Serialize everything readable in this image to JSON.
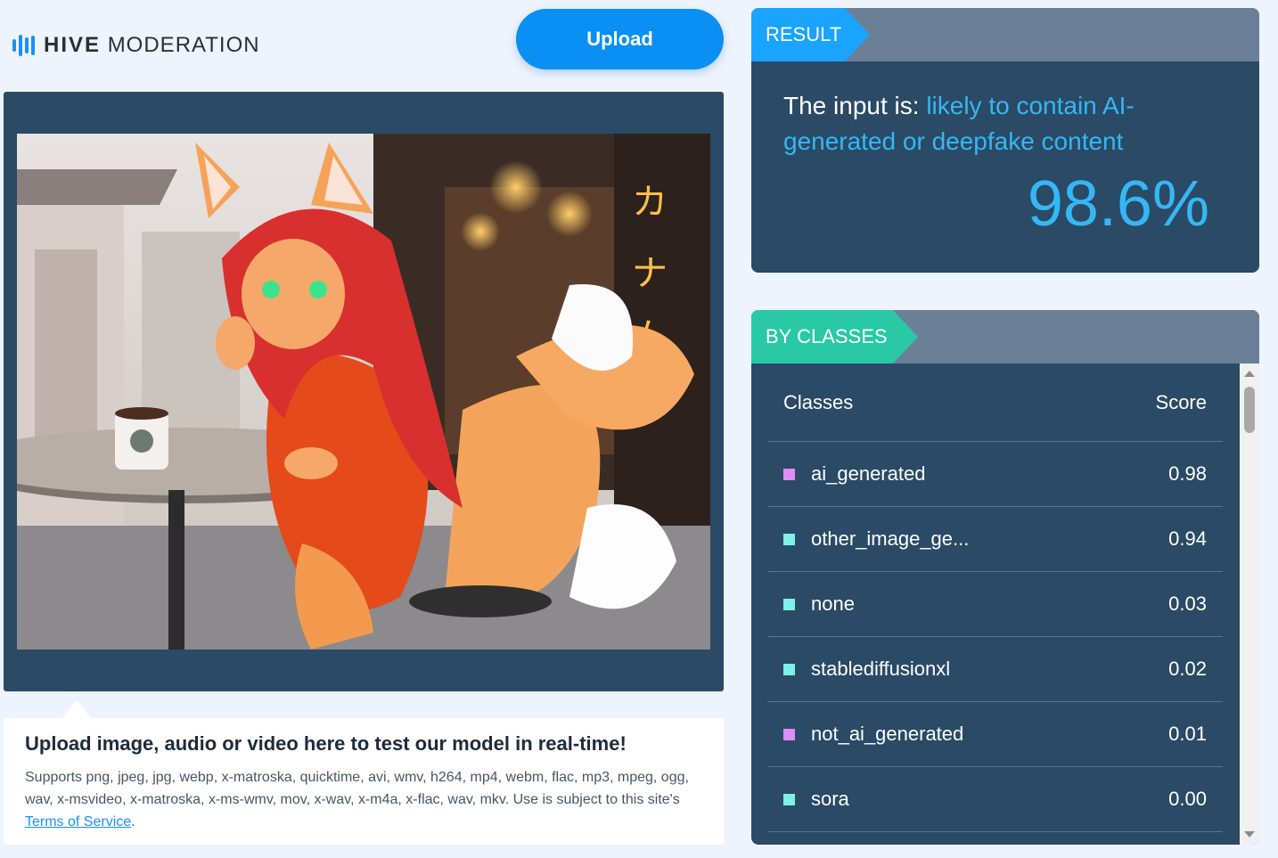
{
  "brand": {
    "bold": "HIVE",
    "light": "MODERATION"
  },
  "upload_button": "Upload",
  "preview": {
    "image_subject": "anime fox girl with red hair in orange dress sitting at café table with coffee mug, three fox tails"
  },
  "info": {
    "title": "Upload image, audio or video here to test our model in real-time!",
    "supports": "Supports png, jpeg, jpg, webp, x-matroska, quicktime, avi, wmv, h264, mp4, webm, flac, mp3, mpeg, ogg, wav, x-msvideo, x-matroska, x-ms-wmv, mov, x-wav, x-m4a, x-flac, wav, mkv. Use is subject to this site's",
    "terms_link": "Terms of Service",
    "period": "."
  },
  "result": {
    "tag": "RESULT",
    "prefix": "The input is: ",
    "verdict": "likely to contain AI-generated or deepfake content",
    "percent": "98.6%"
  },
  "classes": {
    "tag": "BY CLASSES",
    "col_class": "Classes",
    "col_score": "Score",
    "rows": [
      {
        "name": "ai_generated",
        "score": "0.98",
        "color": "#d98ff5"
      },
      {
        "name": "other_image_ge...",
        "score": "0.94",
        "color": "#7ff0e6"
      },
      {
        "name": "none",
        "score": "0.03",
        "color": "#7ff0e6"
      },
      {
        "name": "stablediffusionxl",
        "score": "0.02",
        "color": "#7ff0e6"
      },
      {
        "name": "not_ai_generated",
        "score": "0.01",
        "color": "#d98ff5"
      },
      {
        "name": "sora",
        "score": "0.00",
        "color": "#7ff0e6"
      }
    ]
  },
  "colors": {
    "accent": "#0a8ff5",
    "panel": "#2a4a66",
    "result_tag": "#1aa3ff",
    "classes_tag": "#28c9a4"
  }
}
